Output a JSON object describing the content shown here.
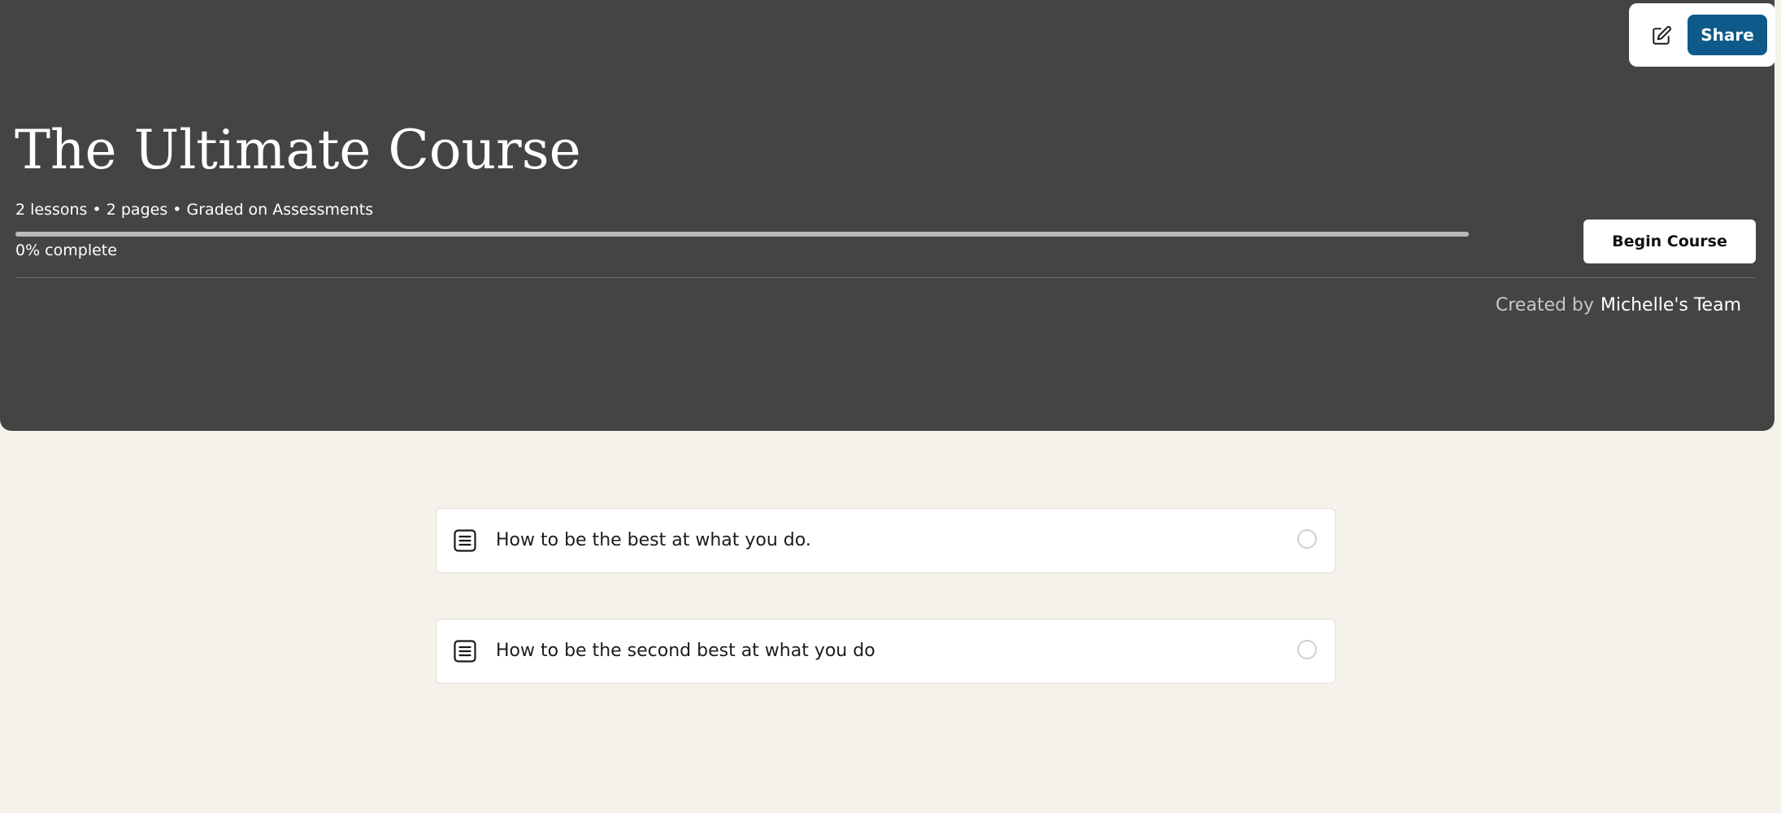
{
  "toolbar": {
    "edit_icon": "pencil-edit-icon",
    "share_label": "Share",
    "share_color": "#0e5a8a"
  },
  "course": {
    "title": "The Ultimate Course",
    "meta": "2 lessons • 2 pages • Graded on Assessments",
    "progress_percent": 0,
    "progress_label": "0% complete",
    "begin_label": "Begin Course",
    "created_by_label": "Created by",
    "creator_name": "Michelle's Team"
  },
  "lessons": [
    {
      "title": "How to be the best at what you do.",
      "icon": "document-icon",
      "completed": false
    },
    {
      "title": "How to be the second best at what you do",
      "icon": "document-icon",
      "completed": false
    }
  ],
  "colors": {
    "hero_background": "#444444",
    "page_background": "#f5f2eb"
  }
}
